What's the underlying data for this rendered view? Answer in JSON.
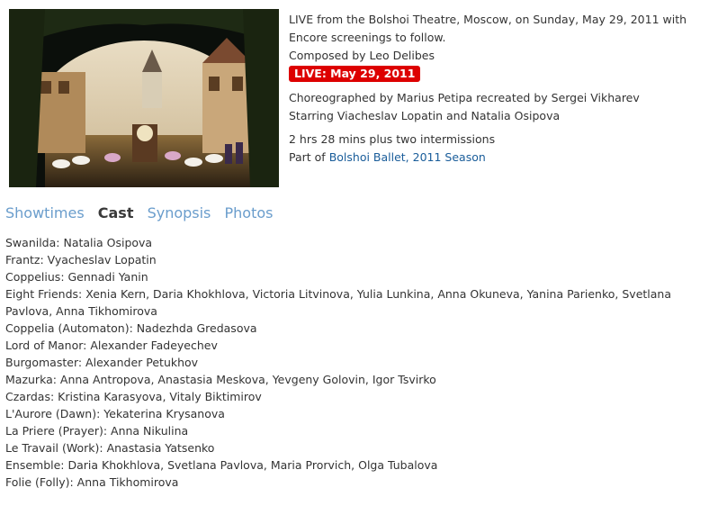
{
  "performance": {
    "headline": "LIVE from the Bolshoi Theatre, Moscow, on Sunday, May 29, 2011 with Encore screenings to follow.",
    "composer": "Composed by Leo Delibes",
    "live_badge": "LIVE: May 29, 2011",
    "choreography": "Choreographed by Marius Petipa recreated by Sergei Vikharev",
    "starring": "Starring Viacheslav Lopatin and Natalia Osipova",
    "duration": "2 hrs 28 mins plus two intermissions",
    "part_of_prefix": "Part of",
    "series_link": "Bolshoi Ballet, 2011 Season"
  },
  "tabs": [
    {
      "label": "Showtimes",
      "active": false
    },
    {
      "label": "Cast",
      "active": true
    },
    {
      "label": "Synopsis",
      "active": false
    },
    {
      "label": "Photos",
      "active": false
    }
  ],
  "cast": [
    "Swanilda: Natalia Osipova",
    "Frantz:  Vyacheslav Lopatin",
    "Coppelius: Gennadi Yanin",
    "Eight Friends: Xenia Kern, Daria Khokhlova, Victoria Litvinova, Yulia Lunkina, Anna Okuneva, Yanina Parienko, Svetlana Pavlova, Anna Tikhomirova",
    "Coppelia (Automaton): Nadezhda Gredasova",
    "Lord of Manor:  Alexander Fadeyechev",
    "Burgomaster: Alexander Petukhov",
    "Mazurka:  Anna Antropova, Anastasia Meskova, Yevgeny Golovin, Igor Tsvirko",
    "Czardas:  Kristina Karasyova, Vitaly Biktimirov",
    "L'Aurore (Dawn): Yekaterina Krysanova",
    "La Priere (Prayer): Anna Nikulina",
    "Le Travail (Work): Anastasia Yatsenko",
    "Ensemble:  Daria Khokhlova, Svetlana Pavlova, Maria Prorvich, Olga Tubalova",
    "Folie (Folly):  Anna Tikhomirova"
  ],
  "colors": {
    "badge": "#dd0000",
    "link": "#1a5d9a",
    "tab": "#6a9dcc",
    "tab_active": "#3a3a3a"
  }
}
